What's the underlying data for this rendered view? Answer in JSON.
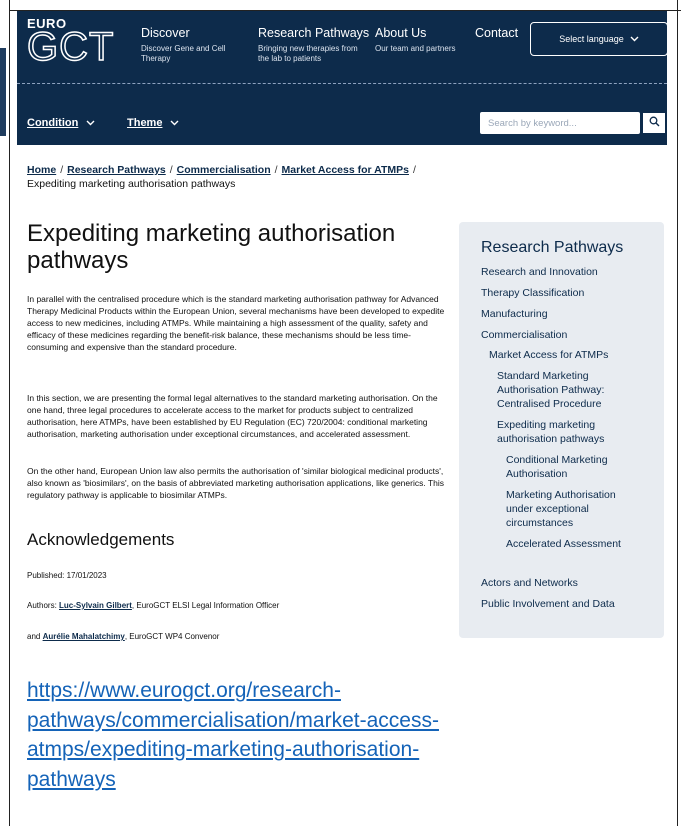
{
  "logo": {
    "top": "EURO",
    "bottom": "GCT"
  },
  "nav": [
    {
      "title": "Discover",
      "sub": "Discover Gene and Cell Therapy"
    },
    {
      "title": "Research Pathways",
      "sub": "Bringing new therapies from the lab to patients"
    },
    {
      "title": "About Us",
      "sub": "Our team and partners"
    },
    {
      "title": "Contact",
      "sub": ""
    }
  ],
  "language": {
    "label": "Select language"
  },
  "subnav": {
    "condition": "Condition",
    "theme": "Theme"
  },
  "search": {
    "placeholder": "Search by keyword..."
  },
  "breadcrumb": {
    "home": "Home",
    "research": "Research Pathways",
    "commercialisation": "Commercialisation",
    "market": "Market Access for ATMPs",
    "current": "Expediting marketing authorisation pathways",
    "sep": "/"
  },
  "page": {
    "title": "Expediting marketing authorisation pathways",
    "para1": "In parallel with the centralised procedure which is the standard marketing authorisation pathway for Advanced Therapy Medicinal Products within the European Union, several mechanisms have been developed to expedite access to new medicines, including ATMPs. While maintaining a high assessment of the quality, safety and efficacy of these medicines regarding the benefit-risk balance, these mechanisms should be less time-consuming and expensive than the standard procedure.",
    "para2": "In this section, we are presenting the formal legal alternatives to the standard marketing authorisation. On the one hand, three legal procedures to accelerate access to the market for products subject to centralized authorisation, here ATMPs, have been established by EU Regulation (EC) 720/2004: conditional marketing authorisation, marketing authorisation under exceptional circumstances, and accelerated assessment.",
    "para3": "On the other hand, European Union law also permits the authorisation of 'similar biological medicinal products', also known as 'biosimilars', on the basis of abbreviated marketing authorisation applications, like generics. This regulatory pathway is applicable to biosimilar ATMPs.",
    "ack_title": "Acknowledgements",
    "published": "Published: 17/01/2023",
    "authors_prefix": "Authors: ",
    "author1": "Luc-Sylvain Gilbert",
    "author1_role": ", EuroGCT ELSI Legal Information Officer",
    "and": "and ",
    "author2": "Aurélie Mahalatchimy",
    "author2_role": ", EuroGCT WP4 Convenor"
  },
  "sidebar": {
    "title": "Research Pathways",
    "items": [
      "Research and Innovation",
      "Therapy Classification",
      "Manufacturing",
      "Commercialisation",
      "Market Access for ATMPs",
      "Standard Marketing",
      "Authorisation Pathway:",
      "Centralised Procedure",
      "Expediting marketing",
      "authorisation pathways",
      "Conditional Marketing",
      "Authorisation",
      "Marketing Authorisation",
      "under exceptional",
      "circumstances",
      "Accelerated Assessment",
      "Actors and Networks",
      "Public Involvement and Data"
    ]
  },
  "url": {
    "line1": "https://www.eurogct.org/research-",
    "line2": "pathways/commercialisation/market-access-",
    "line3": "atmps/expediting-marketing-authorisation-",
    "line4": "pathways"
  }
}
